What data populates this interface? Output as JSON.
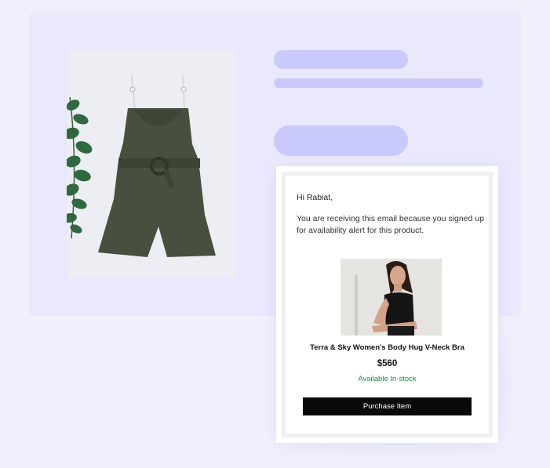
{
  "email": {
    "greeting": "Hi Rabiat,",
    "body": "You are receiving this email because you signed up for availability alert for this product.",
    "product": {
      "name": "Terra & Sky Women's Body Hug V-Neck Bra",
      "price": "$560",
      "availability": "Available In-stock"
    },
    "purchase_label": "Purchase Item"
  },
  "colors": {
    "page_background": "#f0f0fd",
    "card_background": "#e9e8fd",
    "skeleton": "#c9c9fb",
    "in_stock": "#1e8a3c",
    "button": "#0a0a0a"
  }
}
